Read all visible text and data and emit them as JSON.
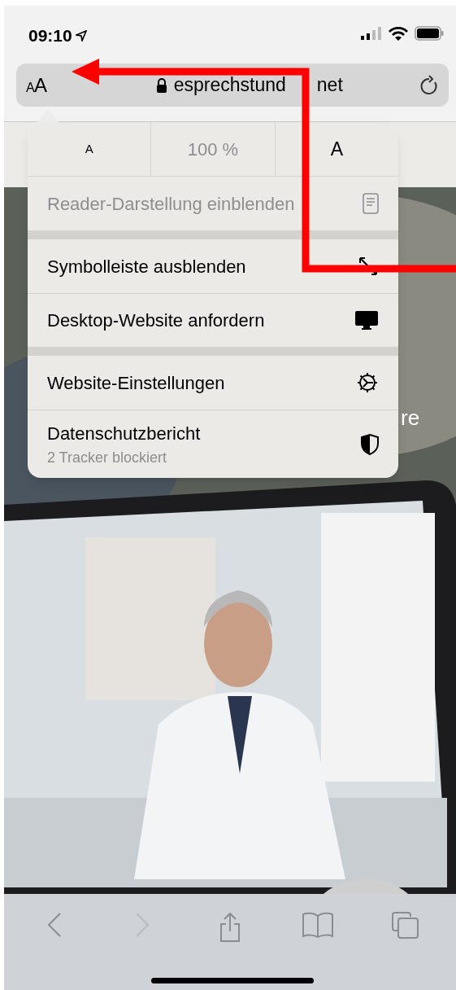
{
  "status_bar": {
    "time": "09:10"
  },
  "address_bar": {
    "text_size_button": "AA",
    "url_parts": [
      "esprechstund",
      "net"
    ]
  },
  "page": {
    "text_fragment": "re"
  },
  "menu": {
    "zoom": {
      "smaller": "A",
      "level_text": "100 %",
      "larger": "A"
    },
    "groups": [
      [
        {
          "label": "Reader-Darstellung einblenden",
          "disabled": true
        }
      ],
      [
        {
          "label": "Symbolleiste ausblenden",
          "disabled": false
        },
        {
          "label": "Desktop-Website anfordern",
          "disabled": false
        }
      ],
      [
        {
          "label": "Website-Einstellungen",
          "disabled": false
        },
        {
          "label": "Datenschutzbericht",
          "sublabel": "2 Tracker blockiert",
          "disabled": false
        }
      ]
    ]
  },
  "toolbar": [
    {
      "disabled": false
    },
    {
      "disabled": true
    },
    {
      "disabled": false
    },
    {
      "disabled": false
    },
    {
      "disabled": false
    }
  ]
}
